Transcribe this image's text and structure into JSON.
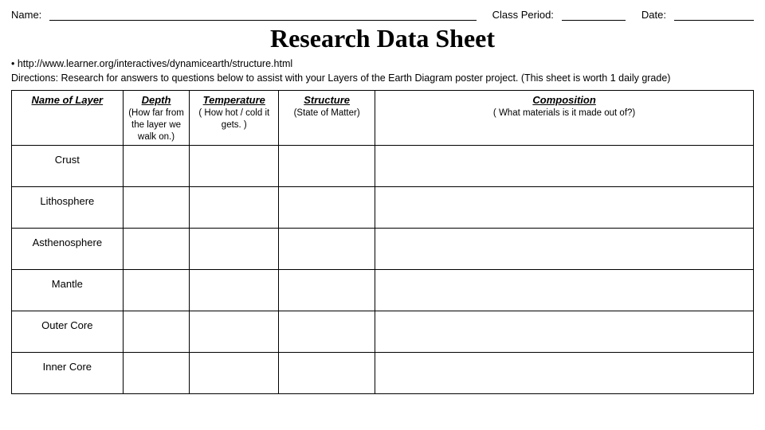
{
  "header": {
    "name_label": "Name: ",
    "class_period_label": "Class Period: ",
    "date_label": "Date: "
  },
  "title": "Research Data Sheet",
  "url": "• http://www.learner.org/interactives/dynamicearth/structure.html",
  "directions": "Directions: Research for answers to questions below to assist with your Layers of the Earth Diagram poster project. (This sheet is worth 1 daily grade)",
  "table": {
    "headers": {
      "name": "Name of Layer",
      "depth": "Depth",
      "depth_sub": "(How far from the layer we walk on.)",
      "temperature": "Temperature",
      "temperature_sub": "( How hot / cold it gets. )",
      "structure": "Structure",
      "structure_sub": "(State of Matter)",
      "composition": "Composition",
      "composition_sub": "( What materials is it made out of?)"
    },
    "rows": [
      {
        "layer": "Crust"
      },
      {
        "layer": "Lithosphere"
      },
      {
        "layer": "Asthenosphere"
      },
      {
        "layer": "Mantle"
      },
      {
        "layer": "Outer Core"
      },
      {
        "layer": "Inner Core"
      }
    ]
  }
}
